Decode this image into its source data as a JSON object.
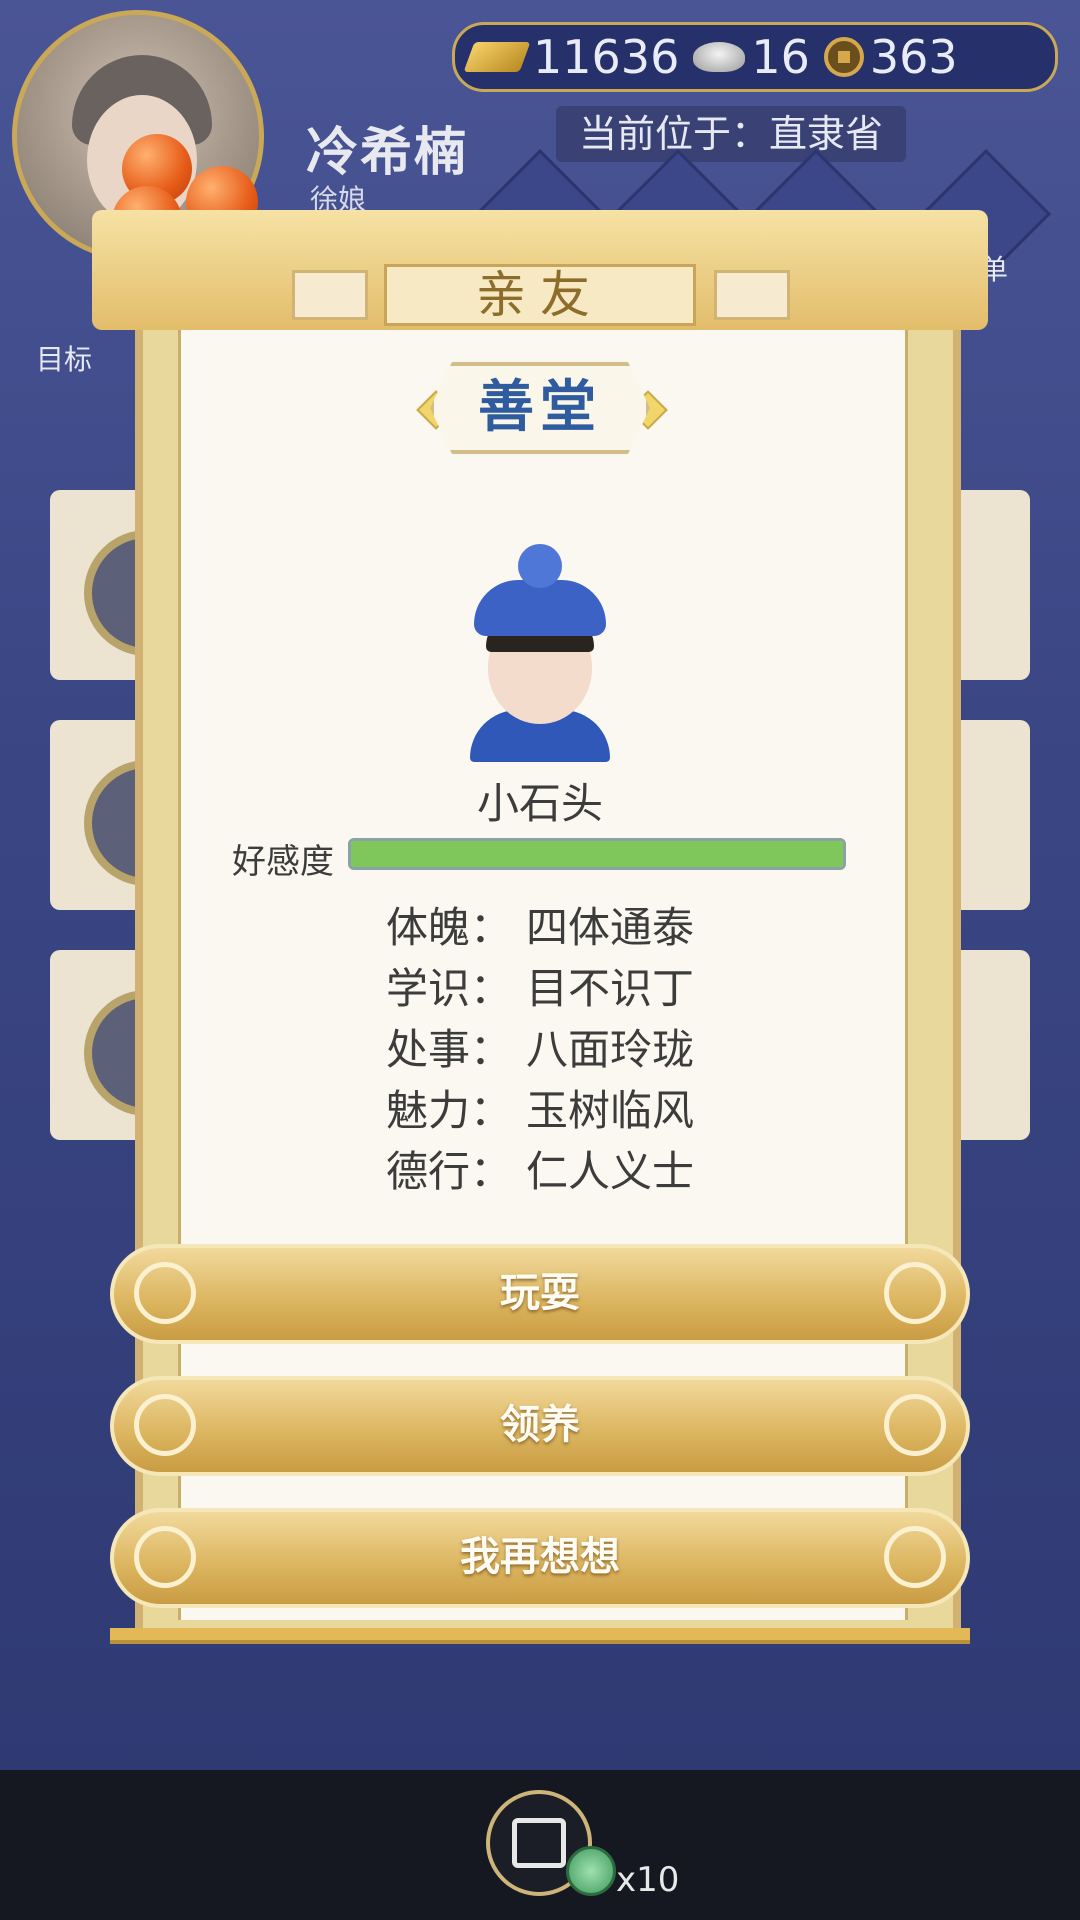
{
  "header": {
    "player_name": "冷希楠",
    "player_title": "徐娘",
    "location": "当前位于：直隶省",
    "menu_label": "菜单",
    "target_label": "目标"
  },
  "currency": {
    "gold": "11636",
    "silver": "16",
    "coins": "363"
  },
  "dialog": {
    "title": "亲友",
    "place": "善堂",
    "character_name": "小石头",
    "favor_label": "好感度",
    "favor_value": 1.0,
    "attributes": [
      {
        "key": "体魄：",
        "value": "四体通泰"
      },
      {
        "key": "学识：",
        "value": "目不识丁"
      },
      {
        "key": "处事：",
        "value": "八面玲珑"
      },
      {
        "key": "魅力：",
        "value": "玉树临风"
      },
      {
        "key": "德行：",
        "value": "仁人义士"
      }
    ],
    "buttons": {
      "play": "玩耍",
      "adopt": "领养",
      "cancel": "我再想想"
    }
  },
  "footer": {
    "share_count": "x10"
  },
  "colors": {
    "accent_gold": "#ddb762",
    "favor_green": "#7fc75a",
    "place_blue": "#2f5b9f"
  }
}
